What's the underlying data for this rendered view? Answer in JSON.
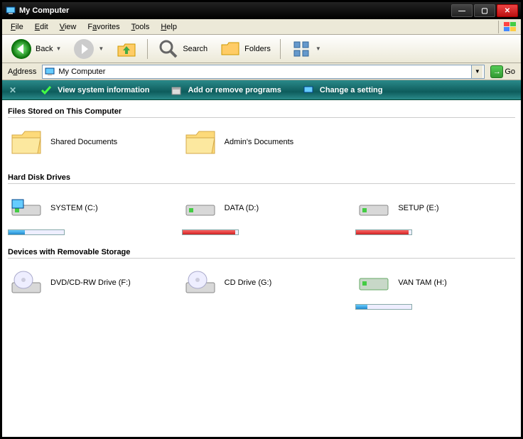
{
  "window": {
    "title": "My Computer"
  },
  "menu": {
    "file": "File",
    "edit": "Edit",
    "view": "View",
    "favorites": "Favorites",
    "tools": "Tools",
    "help": "Help"
  },
  "toolbar": {
    "back": "Back",
    "search": "Search",
    "folders": "Folders"
  },
  "address": {
    "label": "Address",
    "value": "My Computer",
    "go": "Go"
  },
  "tasks": {
    "view_info": "View system information",
    "add_remove": "Add or remove programs",
    "change_setting": "Change a setting"
  },
  "sections": {
    "files": "Files Stored on This Computer",
    "hdd": "Hard Disk Drives",
    "removable": "Devices with Removable Storage"
  },
  "files": [
    {
      "label": "Shared Documents"
    },
    {
      "label": "Admin's Documents"
    }
  ],
  "drives": [
    {
      "label": "SYSTEM (C:)",
      "bar_pct": 30,
      "bar_color": "cap-blue"
    },
    {
      "label": "DATA (D:)",
      "bar_pct": 95,
      "bar_color": "cap-red"
    },
    {
      "label": "SETUP (E:)",
      "bar_pct": 95,
      "bar_color": "cap-red"
    }
  ],
  "removable": [
    {
      "label": "DVD/CD-RW Drive (F:)",
      "type": "optical",
      "has_bar": false
    },
    {
      "label": "CD Drive (G:)",
      "type": "optical",
      "has_bar": false
    },
    {
      "label": "VAN TAM (H:)",
      "type": "usb",
      "has_bar": true,
      "bar_pct": 20,
      "bar_color": "cap-blue"
    }
  ]
}
